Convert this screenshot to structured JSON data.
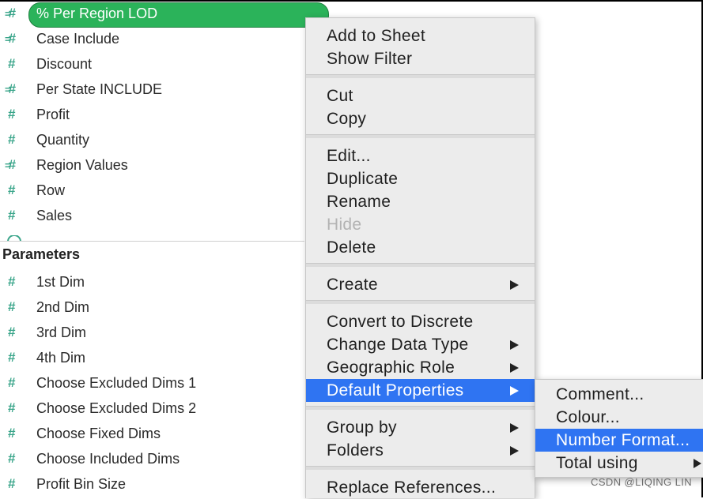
{
  "measures": [
    {
      "label": "% Per Region LOD",
      "icon": "calculated-measure-icon",
      "selected": true
    },
    {
      "label": "Case Include",
      "icon": "calculated-measure-icon",
      "selected": false
    },
    {
      "label": "Discount",
      "icon": "measure-icon",
      "selected": false
    },
    {
      "label": "Per State INCLUDE",
      "icon": "calculated-measure-icon",
      "selected": false
    },
    {
      "label": "Profit",
      "icon": "measure-icon",
      "selected": false
    },
    {
      "label": "Quantity",
      "icon": "measure-icon",
      "selected": false
    },
    {
      "label": "Region Values",
      "icon": "calculated-measure-icon",
      "selected": false
    },
    {
      "label": "Row",
      "icon": "measure-icon",
      "selected": false
    },
    {
      "label": "Sales",
      "icon": "measure-icon",
      "selected": false
    }
  ],
  "parameters_title": "Parameters",
  "parameters": [
    {
      "label": "1st Dim",
      "icon": "parameter-icon"
    },
    {
      "label": "2nd Dim",
      "icon": "parameter-icon"
    },
    {
      "label": "3rd Dim",
      "icon": "parameter-icon"
    },
    {
      "label": "4th Dim",
      "icon": "parameter-icon"
    },
    {
      "label": "Choose Excluded Dims 1",
      "icon": "parameter-icon"
    },
    {
      "label": "Choose Excluded Dims 2",
      "icon": "parameter-icon"
    },
    {
      "label": "Choose Fixed Dims",
      "icon": "parameter-icon"
    },
    {
      "label": "Choose Included Dims",
      "icon": "parameter-icon"
    },
    {
      "label": "Profit Bin Size",
      "icon": "parameter-icon"
    }
  ],
  "context_menu": {
    "items": [
      {
        "label": "Add to Sheet",
        "group": 1
      },
      {
        "label": "Show Filter",
        "group": 1
      },
      {
        "label": "Cut",
        "group": 2
      },
      {
        "label": "Copy",
        "group": 2
      },
      {
        "label": "Edit...",
        "group": 3
      },
      {
        "label": "Duplicate",
        "group": 3
      },
      {
        "label": "Rename",
        "group": 3
      },
      {
        "label": "Hide",
        "group": 3,
        "disabled": true
      },
      {
        "label": "Delete",
        "group": 3
      },
      {
        "label": "Create",
        "group": 4,
        "submenu": true
      },
      {
        "label": "Convert to Discrete",
        "group": 5
      },
      {
        "label": "Change Data Type",
        "group": 5,
        "submenu": true
      },
      {
        "label": "Geographic Role",
        "group": 5,
        "submenu": true
      },
      {
        "label": "Default Properties",
        "group": 5,
        "submenu": true,
        "highlighted": true
      },
      {
        "label": "Group by",
        "group": 6,
        "submenu": true
      },
      {
        "label": "Folders",
        "group": 6,
        "submenu": true
      },
      {
        "label": "Replace References...",
        "group": 7
      }
    ]
  },
  "submenu": {
    "items": [
      {
        "label": "Comment..."
      },
      {
        "label": "Colour..."
      },
      {
        "label": "Number Format...",
        "highlighted": true
      },
      {
        "label": "Total using",
        "submenu": true
      }
    ]
  },
  "watermark": "CSDN @LIQING LIN",
  "colors": {
    "selected_pill": "#2bb35a",
    "menu_highlight": "#2f74f2",
    "measure_icon": "#3aa58a",
    "menu_bg": "#ececec"
  }
}
